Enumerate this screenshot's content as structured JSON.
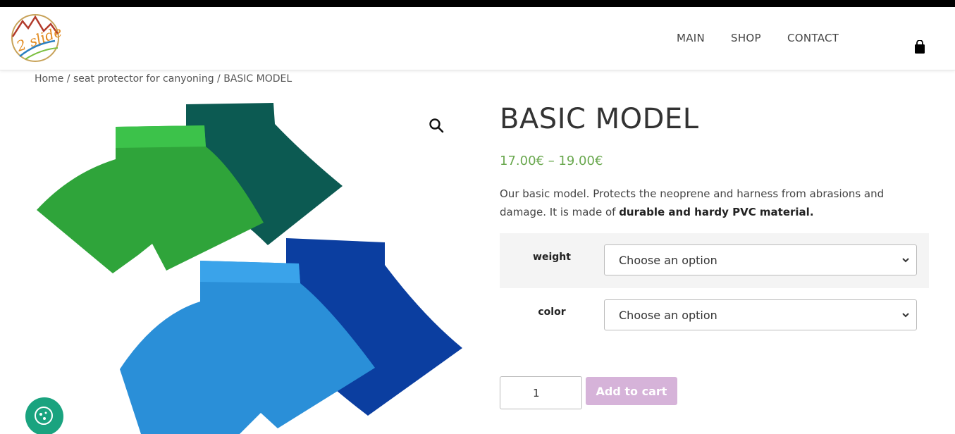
{
  "brand": {
    "logo_text": "2 slide",
    "logo_icon": "mountain-logo"
  },
  "nav": {
    "items": [
      "MAIN",
      "SHOP",
      "CONTACT"
    ],
    "cart_icon": "shopping-bag-icon"
  },
  "breadcrumb": {
    "home": "Home",
    "sep": " / ",
    "category": "seat protector for canyoning",
    "current": "BASIC MODEL"
  },
  "gallery": {
    "zoom_icon": "magnifier-icon",
    "colors": [
      "#2fa43a",
      "#0c5a52",
      "#2a8fd8",
      "#0b3ea0"
    ]
  },
  "product": {
    "title": "BASIC MODEL",
    "price": "17.00€ – 19.00€",
    "description_plain": "Our basic model. Protects the neoprene and harness from abrasions and damage. It is made of ",
    "description_bold": "durable and hardy PVC material."
  },
  "variations": [
    {
      "label": "weight",
      "value": "Choose an option"
    },
    {
      "label": "color",
      "value": "Choose an option"
    }
  ],
  "cart": {
    "quantity": "1",
    "add_label": "Add to cart"
  },
  "colors": {
    "price": "#6aa84f",
    "add_button": "#d6b3d9",
    "chat": "#1aa37f"
  }
}
